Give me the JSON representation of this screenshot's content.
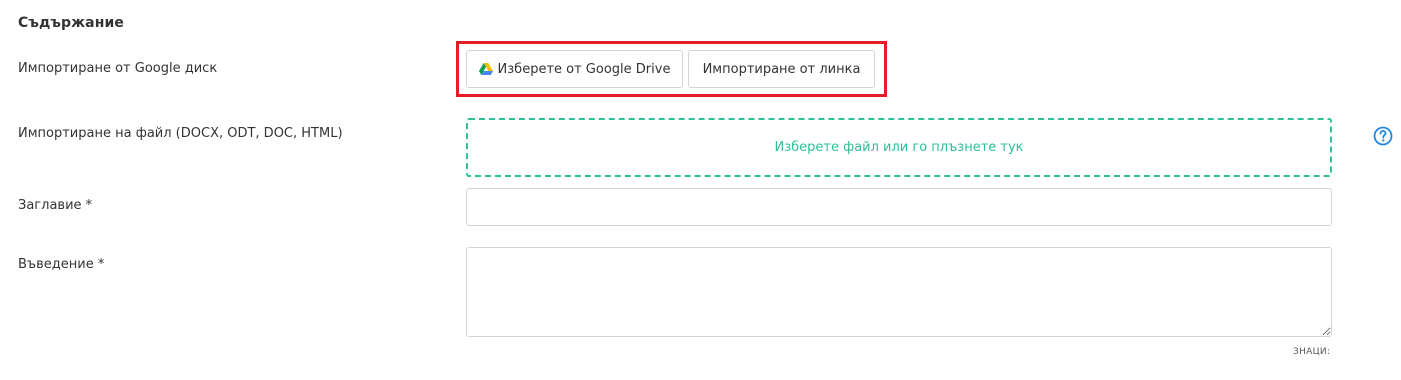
{
  "section": {
    "title": "Съдържание"
  },
  "google_import": {
    "label": "Импортиране от Google диск",
    "choose_button": "Изберете от Google Drive",
    "link_button": "Импортиране от линка"
  },
  "file_import": {
    "label": "Импортиране на файл (DOCX, ODT, DOC, HTML)",
    "dropzone_text": "Изберете файл или го плъзнете тук"
  },
  "title_field": {
    "label": "Заглавие *",
    "value": ""
  },
  "intro_field": {
    "label": "Въведение *",
    "value": "",
    "counter_label": "ЗНАЦИ:"
  },
  "colors": {
    "highlight": "#e21f26",
    "accent": "#2ebf9b",
    "help": "#1e88e5"
  },
  "icons": {
    "google_drive": "google-drive-icon",
    "help": "help-icon"
  }
}
